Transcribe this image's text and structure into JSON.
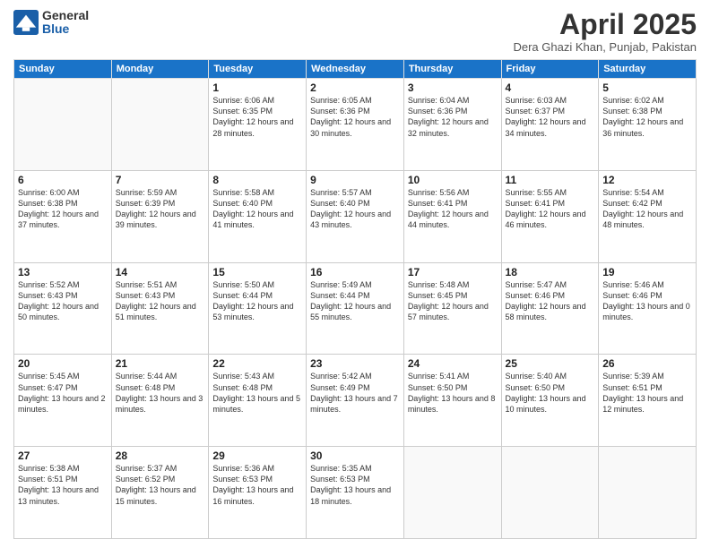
{
  "header": {
    "logo_general": "General",
    "logo_blue": "Blue",
    "month_title": "April 2025",
    "location": "Dera Ghazi Khan, Punjab, Pakistan"
  },
  "days_of_week": [
    "Sunday",
    "Monday",
    "Tuesday",
    "Wednesday",
    "Thursday",
    "Friday",
    "Saturday"
  ],
  "weeks": [
    [
      {
        "day": "",
        "info": ""
      },
      {
        "day": "",
        "info": ""
      },
      {
        "day": "1",
        "info": "Sunrise: 6:06 AM\nSunset: 6:35 PM\nDaylight: 12 hours\nand 28 minutes."
      },
      {
        "day": "2",
        "info": "Sunrise: 6:05 AM\nSunset: 6:36 PM\nDaylight: 12 hours\nand 30 minutes."
      },
      {
        "day": "3",
        "info": "Sunrise: 6:04 AM\nSunset: 6:36 PM\nDaylight: 12 hours\nand 32 minutes."
      },
      {
        "day": "4",
        "info": "Sunrise: 6:03 AM\nSunset: 6:37 PM\nDaylight: 12 hours\nand 34 minutes."
      },
      {
        "day": "5",
        "info": "Sunrise: 6:02 AM\nSunset: 6:38 PM\nDaylight: 12 hours\nand 36 minutes."
      }
    ],
    [
      {
        "day": "6",
        "info": "Sunrise: 6:00 AM\nSunset: 6:38 PM\nDaylight: 12 hours\nand 37 minutes."
      },
      {
        "day": "7",
        "info": "Sunrise: 5:59 AM\nSunset: 6:39 PM\nDaylight: 12 hours\nand 39 minutes."
      },
      {
        "day": "8",
        "info": "Sunrise: 5:58 AM\nSunset: 6:40 PM\nDaylight: 12 hours\nand 41 minutes."
      },
      {
        "day": "9",
        "info": "Sunrise: 5:57 AM\nSunset: 6:40 PM\nDaylight: 12 hours\nand 43 minutes."
      },
      {
        "day": "10",
        "info": "Sunrise: 5:56 AM\nSunset: 6:41 PM\nDaylight: 12 hours\nand 44 minutes."
      },
      {
        "day": "11",
        "info": "Sunrise: 5:55 AM\nSunset: 6:41 PM\nDaylight: 12 hours\nand 46 minutes."
      },
      {
        "day": "12",
        "info": "Sunrise: 5:54 AM\nSunset: 6:42 PM\nDaylight: 12 hours\nand 48 minutes."
      }
    ],
    [
      {
        "day": "13",
        "info": "Sunrise: 5:52 AM\nSunset: 6:43 PM\nDaylight: 12 hours\nand 50 minutes."
      },
      {
        "day": "14",
        "info": "Sunrise: 5:51 AM\nSunset: 6:43 PM\nDaylight: 12 hours\nand 51 minutes."
      },
      {
        "day": "15",
        "info": "Sunrise: 5:50 AM\nSunset: 6:44 PM\nDaylight: 12 hours\nand 53 minutes."
      },
      {
        "day": "16",
        "info": "Sunrise: 5:49 AM\nSunset: 6:44 PM\nDaylight: 12 hours\nand 55 minutes."
      },
      {
        "day": "17",
        "info": "Sunrise: 5:48 AM\nSunset: 6:45 PM\nDaylight: 12 hours\nand 57 minutes."
      },
      {
        "day": "18",
        "info": "Sunrise: 5:47 AM\nSunset: 6:46 PM\nDaylight: 12 hours\nand 58 minutes."
      },
      {
        "day": "19",
        "info": "Sunrise: 5:46 AM\nSunset: 6:46 PM\nDaylight: 13 hours\nand 0 minutes."
      }
    ],
    [
      {
        "day": "20",
        "info": "Sunrise: 5:45 AM\nSunset: 6:47 PM\nDaylight: 13 hours\nand 2 minutes."
      },
      {
        "day": "21",
        "info": "Sunrise: 5:44 AM\nSunset: 6:48 PM\nDaylight: 13 hours\nand 3 minutes."
      },
      {
        "day": "22",
        "info": "Sunrise: 5:43 AM\nSunset: 6:48 PM\nDaylight: 13 hours\nand 5 minutes."
      },
      {
        "day": "23",
        "info": "Sunrise: 5:42 AM\nSunset: 6:49 PM\nDaylight: 13 hours\nand 7 minutes."
      },
      {
        "day": "24",
        "info": "Sunrise: 5:41 AM\nSunset: 6:50 PM\nDaylight: 13 hours\nand 8 minutes."
      },
      {
        "day": "25",
        "info": "Sunrise: 5:40 AM\nSunset: 6:50 PM\nDaylight: 13 hours\nand 10 minutes."
      },
      {
        "day": "26",
        "info": "Sunrise: 5:39 AM\nSunset: 6:51 PM\nDaylight: 13 hours\nand 12 minutes."
      }
    ],
    [
      {
        "day": "27",
        "info": "Sunrise: 5:38 AM\nSunset: 6:51 PM\nDaylight: 13 hours\nand 13 minutes."
      },
      {
        "day": "28",
        "info": "Sunrise: 5:37 AM\nSunset: 6:52 PM\nDaylight: 13 hours\nand 15 minutes."
      },
      {
        "day": "29",
        "info": "Sunrise: 5:36 AM\nSunset: 6:53 PM\nDaylight: 13 hours\nand 16 minutes."
      },
      {
        "day": "30",
        "info": "Sunrise: 5:35 AM\nSunset: 6:53 PM\nDaylight: 13 hours\nand 18 minutes."
      },
      {
        "day": "",
        "info": ""
      },
      {
        "day": "",
        "info": ""
      },
      {
        "day": "",
        "info": ""
      }
    ]
  ]
}
